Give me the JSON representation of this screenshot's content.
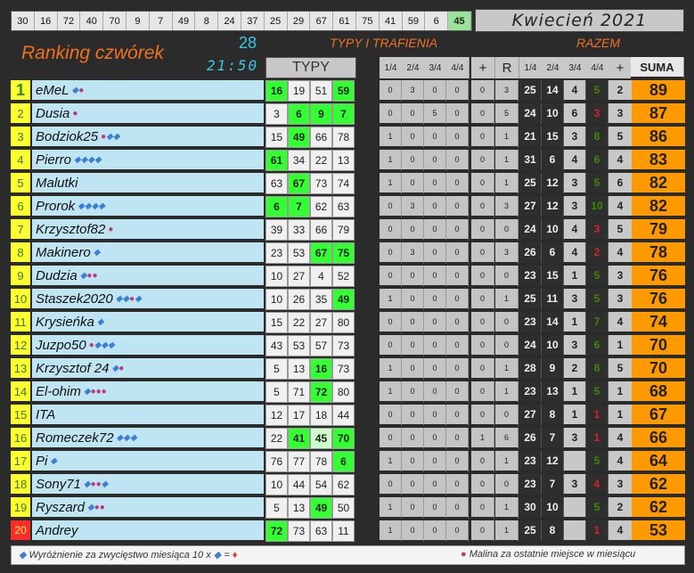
{
  "top_numbers": [
    "30",
    "16",
    "72",
    "40",
    "70",
    "9",
    "7",
    "49",
    "8",
    "24",
    "37",
    "25",
    "29",
    "67",
    "61",
    "75",
    "41",
    "59",
    "6",
    "45"
  ],
  "month": "Kwiecień 2021",
  "title": "Ranking czwórek",
  "count": "28",
  "time": "21:50",
  "section_typy_trafienia": "TYPY I TRAFIENIA",
  "section_razem": "RAZEM",
  "typy_header": "TYPY",
  "stat_headers": [
    "1/4",
    "2/4",
    "3/4",
    "4/4",
    "+",
    "R"
  ],
  "razem_headers": [
    "1/4",
    "2/4",
    "3/4",
    "4/4",
    "+",
    "SUMA"
  ],
  "icon_names": {
    "diamond": "diamond-icon",
    "raspberry": "raspberry-icon"
  },
  "rows": [
    {
      "rank": "1",
      "name": "eMeL",
      "icons": "dr",
      "typy": [
        "16",
        "19",
        "51",
        "59"
      ],
      "hits": [
        1,
        0,
        0,
        1
      ],
      "stats": [
        "0",
        "3",
        "0",
        "0",
        "0",
        "3"
      ],
      "razem": [
        "25",
        "14",
        "4",
        "5",
        "2"
      ],
      "suma": "89"
    },
    {
      "rank": "2",
      "name": "Dusia",
      "icons": "r",
      "typy": [
        "3",
        "6",
        "9",
        "7"
      ],
      "hits": [
        0,
        1,
        1,
        1
      ],
      "stats": [
        "0",
        "0",
        "5",
        "0",
        "0",
        "5"
      ],
      "razem": [
        "24",
        "10",
        "6",
        "3",
        "3"
      ],
      "suma": "87"
    },
    {
      "rank": "3",
      "name": "Bodziok25",
      "icons": "rdd",
      "typy": [
        "15",
        "49",
        "66",
        "78"
      ],
      "hits": [
        0,
        1,
        0,
        0
      ],
      "stats": [
        "1",
        "0",
        "0",
        "0",
        "0",
        "1"
      ],
      "razem": [
        "21",
        "15",
        "3",
        "8",
        "5"
      ],
      "suma": "86"
    },
    {
      "rank": "4",
      "name": "Pierro",
      "icons": "dddd",
      "typy": [
        "61",
        "34",
        "22",
        "13"
      ],
      "hits": [
        1,
        0,
        0,
        0
      ],
      "stats": [
        "1",
        "0",
        "0",
        "0",
        "0",
        "1"
      ],
      "razem": [
        "31",
        "6",
        "4",
        "6",
        "4"
      ],
      "suma": "83"
    },
    {
      "rank": "5",
      "name": "Malutki",
      "icons": "",
      "typy": [
        "63",
        "67",
        "73",
        "74"
      ],
      "hits": [
        0,
        1,
        0,
        0
      ],
      "stats": [
        "1",
        "0",
        "0",
        "0",
        "0",
        "1"
      ],
      "razem": [
        "25",
        "12",
        "3",
        "5",
        "6"
      ],
      "suma": "82"
    },
    {
      "rank": "6",
      "name": "Prorok",
      "icons": "dddd",
      "typy": [
        "6",
        "7",
        "62",
        "63"
      ],
      "hits": [
        1,
        1,
        0,
        0
      ],
      "stats": [
        "0",
        "3",
        "0",
        "0",
        "0",
        "3"
      ],
      "razem": [
        "27",
        "12",
        "3",
        "10",
        "4"
      ],
      "suma": "82"
    },
    {
      "rank": "7",
      "name": "Krzysztof82",
      "icons": "r",
      "typy": [
        "39",
        "33",
        "66",
        "79"
      ],
      "hits": [
        0,
        0,
        0,
        0
      ],
      "stats": [
        "0",
        "0",
        "0",
        "0",
        "0",
        "0"
      ],
      "razem": [
        "24",
        "10",
        "4",
        "3",
        "5"
      ],
      "suma": "79"
    },
    {
      "rank": "8",
      "name": "Makinero",
      "icons": "d",
      "typy": [
        "23",
        "53",
        "67",
        "75"
      ],
      "hits": [
        0,
        0,
        1,
        1
      ],
      "stats": [
        "0",
        "3",
        "0",
        "0",
        "0",
        "3"
      ],
      "razem": [
        "26",
        "6",
        "4",
        "2",
        "4"
      ],
      "suma": "78"
    },
    {
      "rank": "9",
      "name": "Dudzia",
      "icons": "drr",
      "typy": [
        "10",
        "27",
        "4",
        "52"
      ],
      "hits": [
        0,
        0,
        0,
        0
      ],
      "stats": [
        "0",
        "0",
        "0",
        "0",
        "0",
        "0"
      ],
      "razem": [
        "23",
        "15",
        "1",
        "5",
        "3"
      ],
      "suma": "76"
    },
    {
      "rank": "10",
      "name": "Staszek2020",
      "icons": "ddrd",
      "typy": [
        "10",
        "26",
        "35",
        "49"
      ],
      "hits": [
        0,
        0,
        0,
        1
      ],
      "stats": [
        "1",
        "0",
        "0",
        "0",
        "0",
        "1"
      ],
      "razem": [
        "25",
        "11",
        "3",
        "5",
        "3"
      ],
      "suma": "76"
    },
    {
      "rank": "11",
      "name": "Krysieńka",
      "icons": "d",
      "typy": [
        "15",
        "22",
        "27",
        "80"
      ],
      "hits": [
        0,
        0,
        0,
        0
      ],
      "stats": [
        "0",
        "0",
        "0",
        "0",
        "0",
        "0"
      ],
      "razem": [
        "23",
        "14",
        "1",
        "7",
        "4"
      ],
      "suma": "74"
    },
    {
      "rank": "12",
      "name": "Juzpo50",
      "icons": "rddd",
      "typy": [
        "43",
        "53",
        "57",
        "73"
      ],
      "hits": [
        0,
        0,
        0,
        0
      ],
      "stats": [
        "0",
        "0",
        "0",
        "0",
        "0",
        "0"
      ],
      "razem": [
        "24",
        "10",
        "3",
        "6",
        "1"
      ],
      "suma": "70"
    },
    {
      "rank": "13",
      "name": "Krzysztof 24",
      "icons": "dr",
      "typy": [
        "5",
        "13",
        "16",
        "73"
      ],
      "hits": [
        0,
        0,
        1,
        0
      ],
      "stats": [
        "1",
        "0",
        "0",
        "0",
        "0",
        "1"
      ],
      "razem": [
        "28",
        "9",
        "2",
        "8",
        "5"
      ],
      "suma": "70"
    },
    {
      "rank": "14",
      "name": "El-ohim",
      "icons": "drrr",
      "typy": [
        "5",
        "71",
        "72",
        "80"
      ],
      "hits": [
        0,
        0,
        1,
        0
      ],
      "stats": [
        "1",
        "0",
        "0",
        "0",
        "0",
        "1"
      ],
      "razem": [
        "23",
        "13",
        "1",
        "5",
        "1"
      ],
      "suma": "68"
    },
    {
      "rank": "15",
      "name": "ITA",
      "icons": "",
      "typy": [
        "12",
        "17",
        "18",
        "44"
      ],
      "hits": [
        0,
        0,
        0,
        0
      ],
      "stats": [
        "0",
        "0",
        "0",
        "0",
        "0",
        "0"
      ],
      "razem": [
        "27",
        "8",
        "1",
        "1",
        "1"
      ],
      "suma": "67"
    },
    {
      "rank": "16",
      "name": "Romeczek72",
      "icons": "ddd",
      "typy": [
        "22",
        "41",
        "45",
        "70"
      ],
      "hits": [
        0,
        1,
        2,
        1
      ],
      "stats": [
        "0",
        "0",
        "0",
        "0",
        "1",
        "6"
      ],
      "razem": [
        "26",
        "7",
        "3",
        "1",
        "4"
      ],
      "suma": "66"
    },
    {
      "rank": "17",
      "name": "Pi",
      "icons": "d",
      "typy": [
        "76",
        "77",
        "78",
        "6"
      ],
      "hits": [
        0,
        0,
        0,
        1
      ],
      "stats": [
        "1",
        "0",
        "0",
        "0",
        "0",
        "1"
      ],
      "razem": [
        "23",
        "12",
        "",
        "5",
        "4"
      ],
      "suma": "64"
    },
    {
      "rank": "18",
      "name": "Sony71",
      "icons": "drrd",
      "typy": [
        "10",
        "44",
        "54",
        "62"
      ],
      "hits": [
        0,
        0,
        0,
        0
      ],
      "stats": [
        "0",
        "0",
        "0",
        "0",
        "0",
        "0"
      ],
      "razem": [
        "23",
        "7",
        "3",
        "4",
        "3"
      ],
      "suma": "62"
    },
    {
      "rank": "19",
      "name": "Ryszard",
      "icons": "drr",
      "typy": [
        "5",
        "13",
        "49",
        "50"
      ],
      "hits": [
        0,
        0,
        1,
        0
      ],
      "stats": [
        "1",
        "0",
        "0",
        "0",
        "0",
        "1"
      ],
      "razem": [
        "30",
        "10",
        "",
        "5",
        "2"
      ],
      "suma": "62"
    },
    {
      "rank": "20",
      "name": "Andrey",
      "icons": "",
      "typy": [
        "72",
        "73",
        "63",
        "11"
      ],
      "hits": [
        1,
        0,
        0,
        0
      ],
      "stats": [
        "1",
        "0",
        "0",
        "0",
        "0",
        "1"
      ],
      "razem": [
        "25",
        "8",
        "",
        "1",
        "4"
      ],
      "suma": "53"
    }
  ],
  "footer": {
    "left": "Wyróżnienie za zwycięstwo miesiąca  10 x",
    "equals": "=",
    "right": "Malina za ostatnie miejsce w miesiącu"
  },
  "colors": {
    "accent_orange": "#f07020",
    "cyan": "#38c8e8",
    "hit_green": "#33ff33",
    "suma_orange": "#ff9900"
  }
}
